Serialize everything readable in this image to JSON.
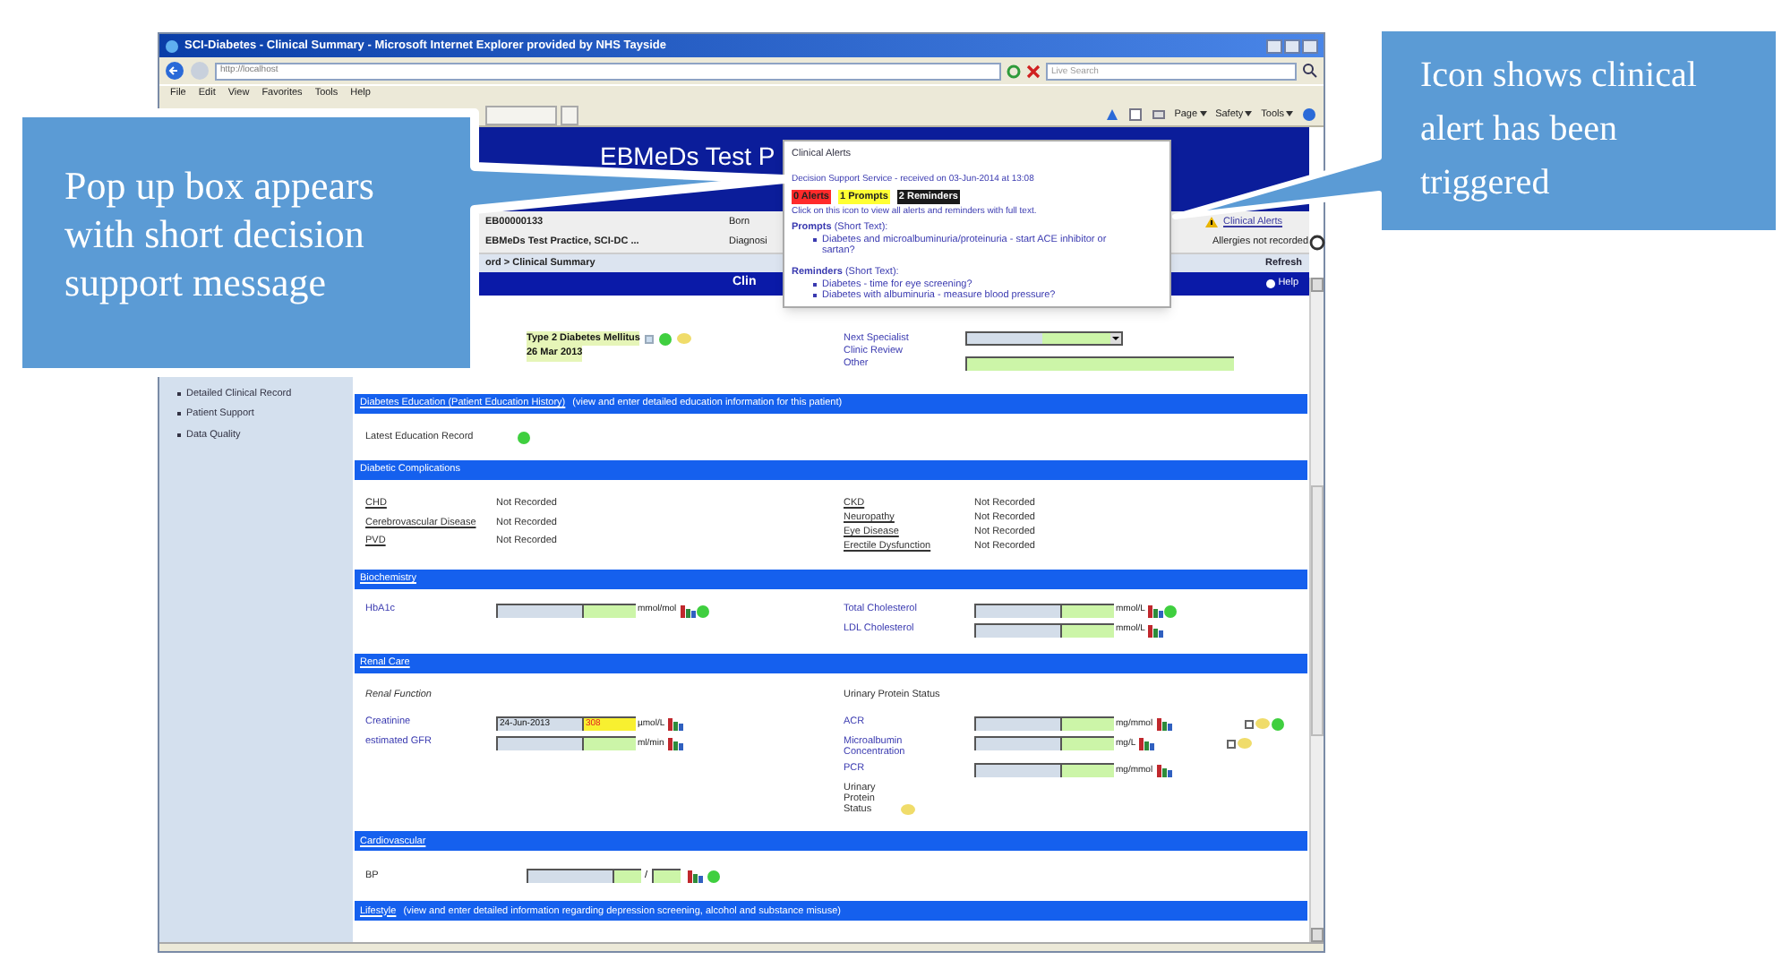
{
  "window": {
    "title": "SCI-Diabetes - Clinical Summary - Microsoft Internet Explorer provided by NHS Tayside",
    "address": "http://localhost",
    "search_placeholder": "Live Search",
    "menu": [
      "File",
      "Edit",
      "View",
      "Favorites",
      "Tools",
      "Help"
    ],
    "commands": [
      "Page",
      "Safety",
      "Tools"
    ]
  },
  "header": {
    "title": "EBMeDs Test P"
  },
  "patient": {
    "id": "EB00000133",
    "born_label": "Born",
    "practice": "EBMeDs Test Practice, SCI-DC ...",
    "diagnosis_label": "Diagnosi",
    "alert_link": "Clinical Alerts",
    "allergies": "Allergies not recorded"
  },
  "breadcrumb": "ord > Clinical Summary",
  "refresh": "Refresh",
  "page_title": "Clin",
  "help": "Help",
  "sidebar": [
    "Detailed Clinical Record",
    "Patient Support",
    "Data Quality"
  ],
  "diagnosis": {
    "text": "Type 2 Diabetes Mellitus",
    "date": "26 Mar 2013",
    "labels": [
      "Next Specialist",
      "Clinic Review",
      "Other"
    ]
  },
  "sections": [
    {
      "kind": "education",
      "heading": "Diabetes Education (Patient Education History)",
      "link": true,
      "note": "(view and enter detailed education information for this patient)",
      "label": "Latest Education Record"
    },
    {
      "kind": "complications",
      "heading": "Diabetic Complications",
      "link": false,
      "left": [
        {
          "label": "CHD",
          "value": "Not Recorded"
        },
        {
          "label": "Cerebrovascular Disease",
          "value": "Not Recorded"
        },
        {
          "label": "PVD",
          "value": "Not Recorded"
        }
      ],
      "right": [
        {
          "label": "CKD",
          "value": "Not Recorded"
        },
        {
          "label": "Neuropathy",
          "value": "Not Recorded"
        },
        {
          "label": "Eye Disease",
          "value": "Not Recorded"
        },
        {
          "label": "Erectile Dysfunction",
          "value": "Not Recorded"
        }
      ]
    },
    {
      "kind": "measures",
      "heading": "Biochemistry",
      "link": true,
      "left": [
        {
          "label": "HbA1c",
          "unit": "mmol/mol",
          "flagged": false,
          "dot": true
        }
      ],
      "right": [
        {
          "label": "Total Cholesterol",
          "unit": "mmol/L",
          "flagged": false,
          "dot": true
        },
        {
          "label": "LDL Cholesterol",
          "unit": "mmol/L",
          "flagged": false,
          "dot": false
        }
      ]
    },
    {
      "kind": "measures",
      "heading": "Renal Care",
      "link": true,
      "left_title": "Renal Function",
      "right_title": "Urinary Protein Status",
      "left": [
        {
          "label": "Creatinine",
          "date": "24-Jun-2013",
          "value": "308",
          "unit": "µmol/L",
          "flagged": true,
          "dot": false
        },
        {
          "label": "estimated GFR",
          "unit": "ml/min",
          "flagged": false,
          "dot": false
        }
      ],
      "right": [
        {
          "label": "ACR",
          "unit": "mg/mmol",
          "flagged": false,
          "dot": false,
          "checked": false,
          "side_dot": true
        },
        {
          "label": "Microalbumin Concentration",
          "unit": "mg/L",
          "flagged": false,
          "dot": false,
          "checked": false,
          "side_dot": false
        },
        {
          "label": "PCR",
          "unit": "mg/mmol",
          "flagged": false,
          "dot": false
        }
      ],
      "right_footer": "Urinary Protein Status"
    },
    {
      "kind": "bp",
      "heading": "Cardiovascular",
      "link": true,
      "label": "BP",
      "separator": "/"
    },
    {
      "kind": "note",
      "heading": "Lifestyle",
      "link": true,
      "note": "(view and enter detailed information regarding depression screening, alcohol and substance misuse)"
    }
  ],
  "popup": {
    "title": "Clinical Alerts",
    "received": "Decision Support Service - received on 03-Jun-2014 at 13:08",
    "badges": [
      {
        "text": "0 Alerts",
        "color": "#ff2a2a"
      },
      {
        "text": "1 Prompts",
        "color": "#ffff33"
      },
      {
        "text": "2 Reminders",
        "color": "#1a1a1a"
      }
    ],
    "hint": "Click on this icon to view all alerts and reminders with full text.",
    "groups": [
      {
        "heading": "**Prompts** (Short Text):",
        "items": [
          "Diabetes and microalbuminuria/proteinuria - start ACE inhibitor or sartan?"
        ]
      },
      {
        "heading": "**Reminders** (Short Text):",
        "items": [
          "Diabetes - time for eye screening?",
          "Diabetes with albuminuria - measure blood pressure?"
        ]
      }
    ]
  },
  "callouts": [
    {
      "text": "Pop up box appears with short decision support message"
    },
    {
      "text": "Icon shows clinical alert has been triggered"
    }
  ]
}
